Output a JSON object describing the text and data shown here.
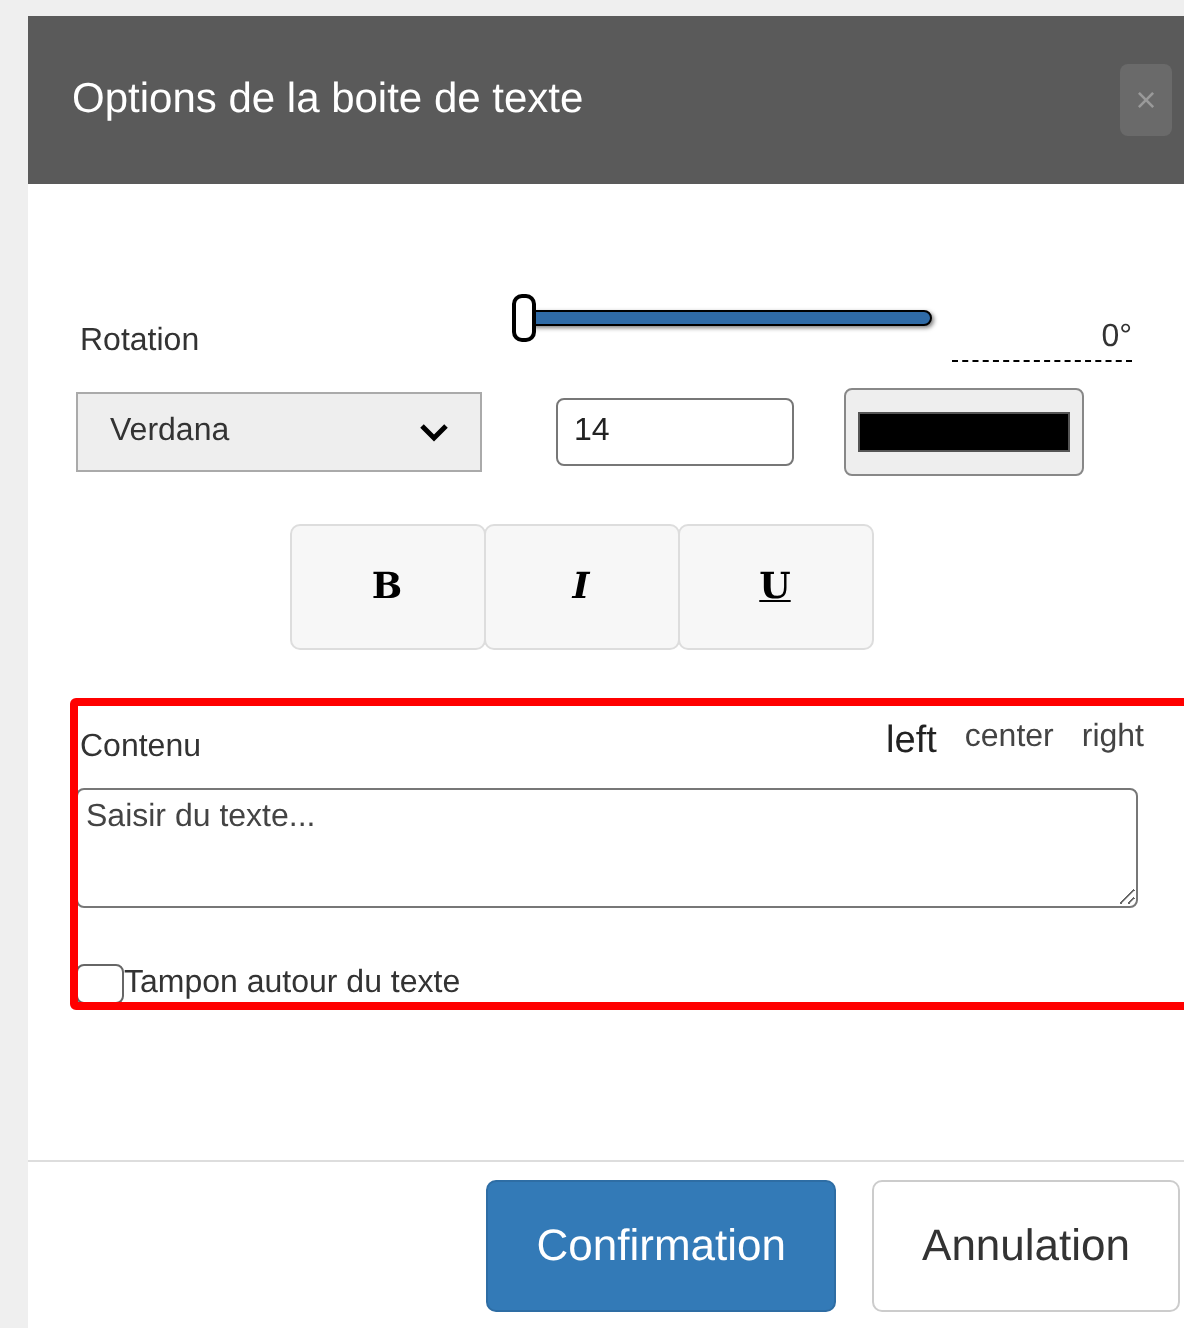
{
  "dialog": {
    "title": "Options de la boite de texte",
    "close": "×"
  },
  "rotation": {
    "label": "Rotation",
    "level": 0,
    "reading": "0°"
  },
  "font": {
    "family": "Verdana",
    "size": "14",
    "color": "#000000"
  },
  "style_buttons": [
    {
      "label": "B",
      "kind": "bold"
    },
    {
      "label": "I",
      "kind": "italic"
    },
    {
      "label": "U",
      "kind": "underline"
    }
  ],
  "content": {
    "label": "Contenu",
    "alignments": [
      {
        "label": "left",
        "selected": true
      },
      {
        "label": "center",
        "selected": false
      },
      {
        "label": "right",
        "selected": false
      }
    ],
    "placeholder": "Saisir du texte..."
  },
  "padding_option": {
    "label": "Tampon autour du texte",
    "checked": false
  },
  "highlight": {
    "on": true,
    "color": "#ff0000"
  },
  "buttons": [
    {
      "label": "Confirmation",
      "kind": "primary"
    },
    {
      "label": "Annulation",
      "kind": "default"
    }
  ]
}
